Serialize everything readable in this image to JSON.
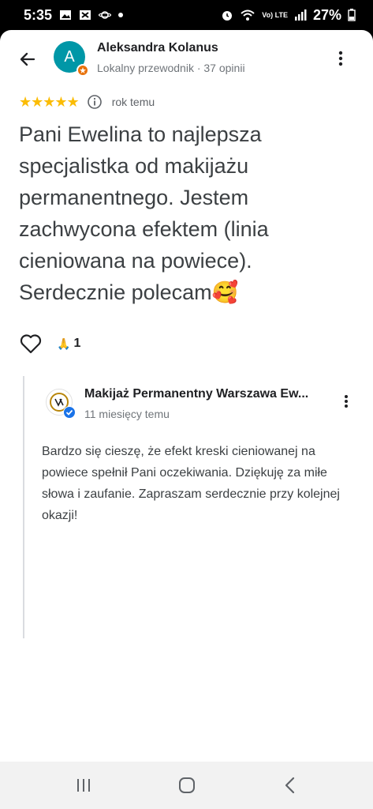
{
  "status_bar": {
    "time": "5:35",
    "network": "Vo) LTE",
    "battery": "27%"
  },
  "header": {
    "avatar_letter": "A",
    "author_name": "Aleksandra Kolanus",
    "author_meta": "Lokalny przewodnik · 37 opinii"
  },
  "review": {
    "stars": "★★★★★",
    "rating_value": 5,
    "time": "rok temu",
    "text": "Pani Ewelina to najlepsza specjalistka od makijażu permanentnego. Jestem zachwycona efektem (linia cieniowana na powiece). Serdecznie polecam🥰",
    "reaction_emoji": "🙏",
    "reaction_count": "1"
  },
  "owner_reply": {
    "business_name": "Makijaż Permanentny Warszawa Ew...",
    "time": "11 miesięcy temu",
    "text": "Bardzo się cieszę, że efekt kreski cieniowanej na powiece spełnił Pani oczekiwania. Dziękuję za miłe słowa i zaufanie. Zapraszam serdecznie przy kolejnej okazji!"
  },
  "icons": {
    "back": "arrow-back-icon",
    "more": "more-vert-icon",
    "info": "info-icon",
    "like": "heart-outline-icon",
    "verified": "verified-check-icon",
    "nav_recents": "recents-icon",
    "nav_home": "home-icon",
    "nav_back": "nav-back-icon"
  },
  "colors": {
    "star": "#fbbc04",
    "avatar_bg": "#0097a7",
    "local_guide_badge": "#e8710a",
    "verified": "#1a73e8"
  }
}
